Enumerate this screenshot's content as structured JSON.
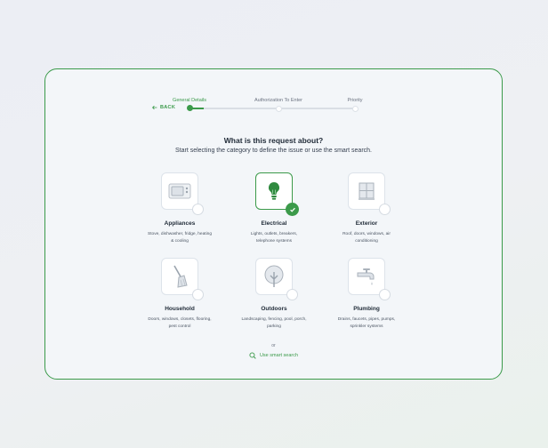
{
  "nav": {
    "back_label": "BACK"
  },
  "stepper": {
    "steps": [
      {
        "label": "General Details",
        "state": "active"
      },
      {
        "label": "Authorization To Enter",
        "state": "pending"
      },
      {
        "label": "Priority",
        "state": "pending"
      }
    ]
  },
  "heading": {
    "title": "What is this request about?",
    "subtitle": "Start selecting the category to define the issue or use the smart search."
  },
  "categories": [
    {
      "name": "Appliances",
      "description": "Stove, dishwasher, fridge, heating & cooling",
      "icon": "microwave-icon",
      "selected": false
    },
    {
      "name": "Electrical",
      "description": "Lights, outlets, breakers, telephone systems",
      "icon": "lightbulb-icon",
      "selected": true
    },
    {
      "name": "Exterior",
      "description": "Roof, doors, windows, air conditioning",
      "icon": "window-icon",
      "selected": false
    },
    {
      "name": "Household",
      "description": "Doors, windows, closets, flooring, pest control",
      "icon": "broom-icon",
      "selected": false
    },
    {
      "name": "Outdoors",
      "description": "Landscaping, fencing, pool, porch, parking",
      "icon": "tree-icon",
      "selected": false
    },
    {
      "name": "Plumbing",
      "description": "Drains, faucets, pipes, pumps, sprinkler systems",
      "icon": "faucet-icon",
      "selected": false
    }
  ],
  "footer": {
    "or_label": "or",
    "smart_search_label": "Use smart search"
  },
  "colors": {
    "accent": "#3b9a4a",
    "border": "#dde3ea",
    "card_bg": "#f3f6f9"
  }
}
